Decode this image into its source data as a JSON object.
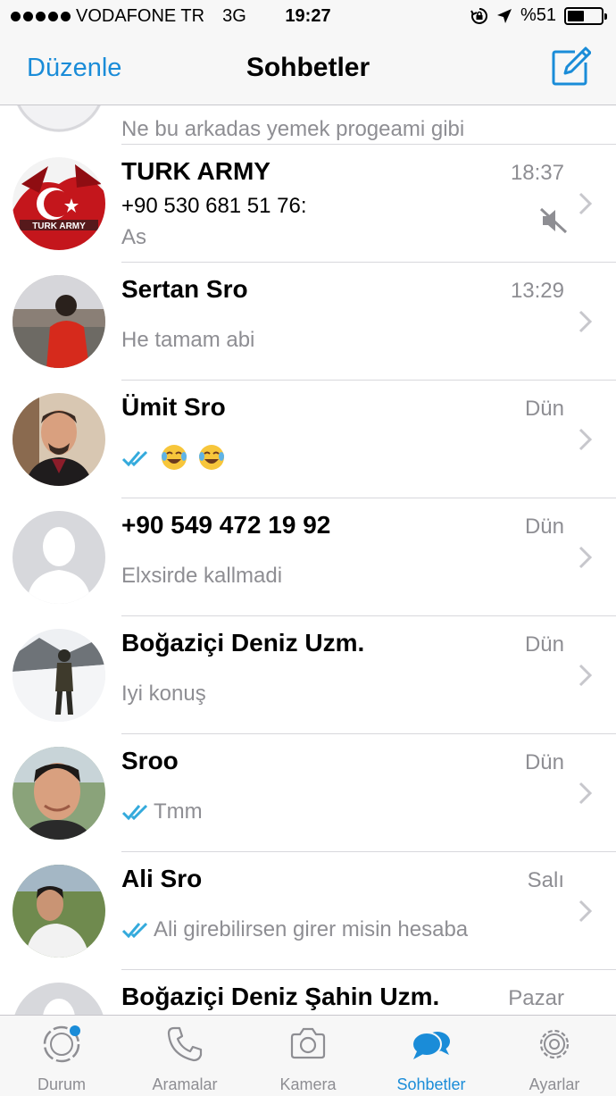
{
  "status_bar": {
    "carrier": "VODAFONE TR",
    "network": "3G",
    "time": "19:27",
    "battery": "%51",
    "battery_level": 0.51
  },
  "nav": {
    "edit_label": "Düzenle",
    "title": "Sohbetler",
    "accent_color": "#1a8cd8"
  },
  "chats": [
    {
      "name": "",
      "time": "",
      "message": "Ne bu arkadas yemek progeami gibi"
    },
    {
      "name": "TURK ARMY",
      "time": "18:37",
      "sender": "+90 530 681 51 76:",
      "message": "As",
      "muted": true
    },
    {
      "name": "Sertan Sro",
      "time": "13:29",
      "message": "He tamam abi"
    },
    {
      "name": "Ümit Sro",
      "time": "Dün",
      "message": "",
      "read_ticks": true,
      "emoji": [
        "joy",
        "joy"
      ]
    },
    {
      "name": "+90 549 472 19 92",
      "time": "Dün",
      "message": "Elxsirde kallmadi"
    },
    {
      "name": "Boğaziçi Deniz Uzm.",
      "time": "Dün",
      "message": "Iyi konuş"
    },
    {
      "name": "Sroo",
      "time": "Dün",
      "message": "Tmm",
      "read_ticks": true
    },
    {
      "name": "Ali Sro",
      "time": "Salı",
      "message": "Ali girebilirsen girer misin hesaba",
      "read_ticks": true
    },
    {
      "name": "Boğaziçi Deniz Şahin Uzm.",
      "time": "Pazar",
      "message": ""
    }
  ],
  "tabs": [
    {
      "label": "Durum",
      "icon": "status-icon"
    },
    {
      "label": "Aramalar",
      "icon": "phone-icon"
    },
    {
      "label": "Kamera",
      "icon": "camera-icon"
    },
    {
      "label": "Sohbetler",
      "icon": "chats-icon",
      "active": true
    },
    {
      "label": "Ayarlar",
      "icon": "gear-icon"
    }
  ]
}
